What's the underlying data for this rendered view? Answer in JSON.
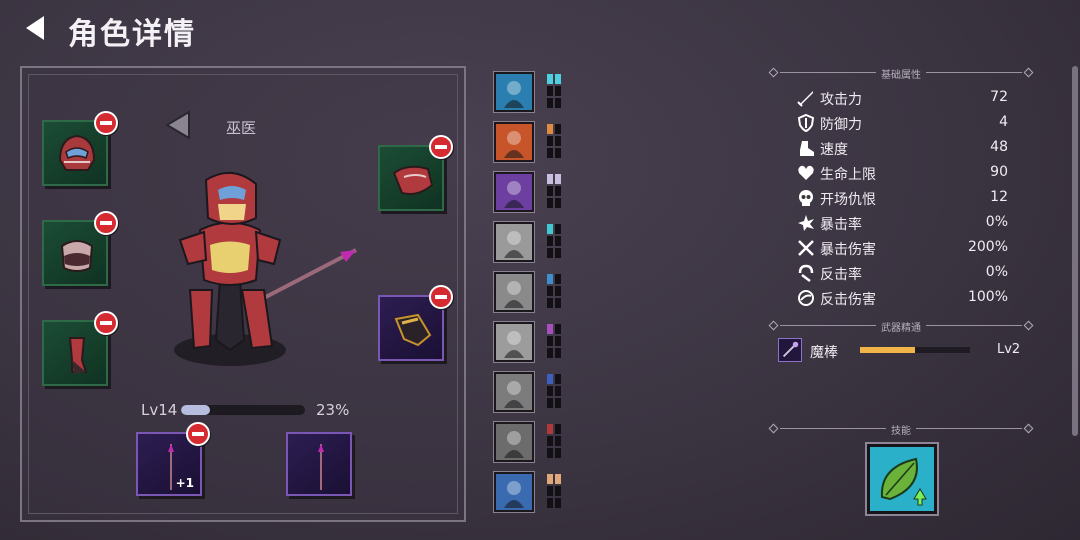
{
  "header": {
    "title": "角色详情",
    "back_icon": "back-arrow-icon"
  },
  "character": {
    "class_name": "巫医",
    "level_label": "Lv14",
    "xp_percent_label": "23%",
    "xp_fraction": 0.23
  },
  "equipment": {
    "weapon_slot_1_enhance": "+1"
  },
  "skill_list": [
    {
      "icon": "warrior-skill-icon",
      "pips": [
        "#4fd0e0",
        "#4fd0e0",
        "#121014",
        "#121014",
        "#121014",
        "#121014"
      ],
      "bg": "#2a7fb0"
    },
    {
      "icon": "fire-sword-skill-icon",
      "pips": [
        "#e08a3f",
        "#121014",
        "#121014",
        "#121014",
        "#121014",
        "#121014"
      ],
      "bg": "#c8552a"
    },
    {
      "icon": "purple-slash-skill-icon",
      "pips": [
        "#c7bfe0",
        "#c7bfe0",
        "#121014",
        "#121014",
        "#121014",
        "#121014"
      ],
      "bg": "#6c3fa0"
    },
    {
      "icon": "shadow-dash-skill-icon",
      "pips": [
        "#3fc9d0",
        "#121014",
        "#121014",
        "#121014",
        "#121014",
        "#121014"
      ],
      "bg": "#9a9a9a"
    },
    {
      "icon": "beast-roar-skill-icon",
      "pips": [
        "#3f8fd0",
        "#121014",
        "#121014",
        "#121014",
        "#121014",
        "#121014"
      ],
      "bg": "#8a8a8a"
    },
    {
      "icon": "stone-face-skill-icon",
      "pips": [
        "#a84fc0",
        "#121014",
        "#121014",
        "#121014",
        "#121014",
        "#121014"
      ],
      "bg": "#9c9c9c"
    },
    {
      "icon": "hooded-figure-skill-icon",
      "pips": [
        "#3f5fc0",
        "#121014",
        "#121014",
        "#121014",
        "#121014",
        "#121014"
      ],
      "bg": "#7c7c7c"
    },
    {
      "icon": "demon-skill-icon",
      "pips": [
        "#b03a3a",
        "#121014",
        "#121014",
        "#121014",
        "#121014",
        "#121014"
      ],
      "bg": "#6c6c6c"
    },
    {
      "icon": "orb-skill-icon",
      "pips": [
        "#e0a87a",
        "#e0a87a",
        "#121014",
        "#121014",
        "#121014",
        "#121014"
      ],
      "bg": "#3a6ab0"
    }
  ],
  "stats_section": {
    "title": "基础属性",
    "rows": [
      {
        "icon": "sword-icon",
        "name": "攻击力",
        "value": "72"
      },
      {
        "icon": "shield-icon",
        "name": "防御力",
        "value": "4"
      },
      {
        "icon": "boot-icon",
        "name": "速度",
        "value": "48"
      },
      {
        "icon": "heart-icon",
        "name": "生命上限",
        "value": "90"
      },
      {
        "icon": "skull-icon",
        "name": "开场仇恨",
        "value": "12"
      },
      {
        "icon": "crit-burst-icon",
        "name": "暴击率",
        "value": "0%"
      },
      {
        "icon": "crossed-swords-icon",
        "name": "暴击伤害",
        "value": "200%"
      },
      {
        "icon": "counter-icon",
        "name": "反击率",
        "value": "0%"
      },
      {
        "icon": "counter-damage-icon",
        "name": "反击伤害",
        "value": "100%"
      }
    ]
  },
  "mastery_section": {
    "title": "武器精通",
    "weapon_name": "魔棒",
    "level": "Lv2",
    "progress_fraction": 0.5
  },
  "skills_section": {
    "title": "技能",
    "skill_icon": "leaf-upgrade-skill-icon"
  }
}
